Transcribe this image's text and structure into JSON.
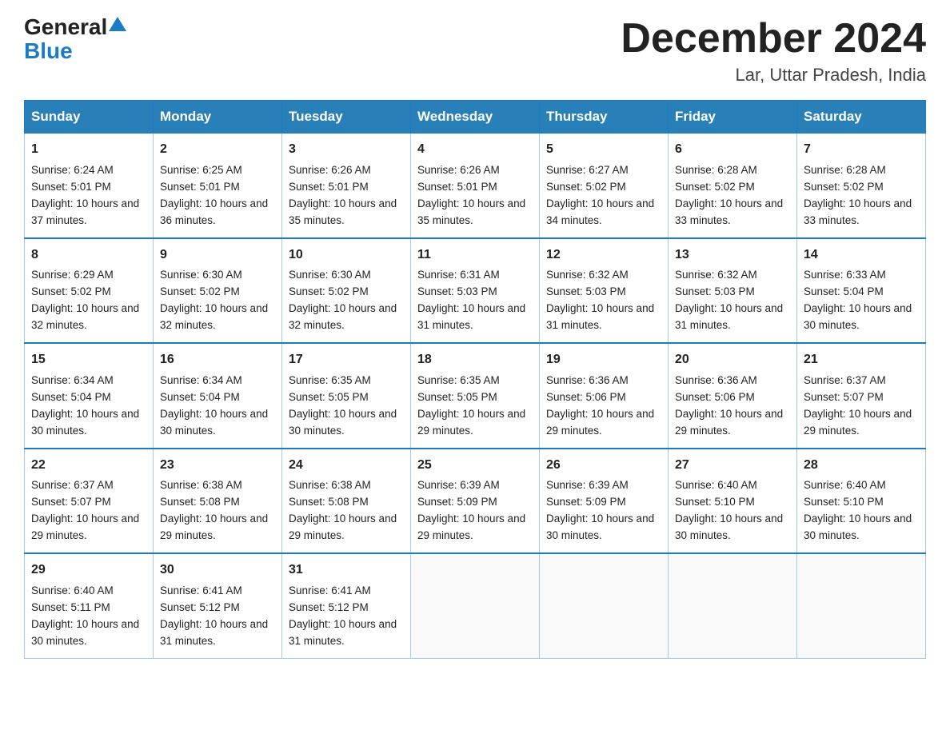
{
  "logo": {
    "general": "General",
    "blue": "Blue",
    "triangle": "▲"
  },
  "title": "December 2024",
  "location": "Lar, Uttar Pradesh, India",
  "days_of_week": [
    "Sunday",
    "Monday",
    "Tuesday",
    "Wednesday",
    "Thursday",
    "Friday",
    "Saturday"
  ],
  "weeks": [
    [
      {
        "day": "1",
        "sunrise": "6:24 AM",
        "sunset": "5:01 PM",
        "daylight": "10 hours and 37 minutes."
      },
      {
        "day": "2",
        "sunrise": "6:25 AM",
        "sunset": "5:01 PM",
        "daylight": "10 hours and 36 minutes."
      },
      {
        "day": "3",
        "sunrise": "6:26 AM",
        "sunset": "5:01 PM",
        "daylight": "10 hours and 35 minutes."
      },
      {
        "day": "4",
        "sunrise": "6:26 AM",
        "sunset": "5:01 PM",
        "daylight": "10 hours and 35 minutes."
      },
      {
        "day": "5",
        "sunrise": "6:27 AM",
        "sunset": "5:02 PM",
        "daylight": "10 hours and 34 minutes."
      },
      {
        "day": "6",
        "sunrise": "6:28 AM",
        "sunset": "5:02 PM",
        "daylight": "10 hours and 33 minutes."
      },
      {
        "day": "7",
        "sunrise": "6:28 AM",
        "sunset": "5:02 PM",
        "daylight": "10 hours and 33 minutes."
      }
    ],
    [
      {
        "day": "8",
        "sunrise": "6:29 AM",
        "sunset": "5:02 PM",
        "daylight": "10 hours and 32 minutes."
      },
      {
        "day": "9",
        "sunrise": "6:30 AM",
        "sunset": "5:02 PM",
        "daylight": "10 hours and 32 minutes."
      },
      {
        "day": "10",
        "sunrise": "6:30 AM",
        "sunset": "5:02 PM",
        "daylight": "10 hours and 32 minutes."
      },
      {
        "day": "11",
        "sunrise": "6:31 AM",
        "sunset": "5:03 PM",
        "daylight": "10 hours and 31 minutes."
      },
      {
        "day": "12",
        "sunrise": "6:32 AM",
        "sunset": "5:03 PM",
        "daylight": "10 hours and 31 minutes."
      },
      {
        "day": "13",
        "sunrise": "6:32 AM",
        "sunset": "5:03 PM",
        "daylight": "10 hours and 31 minutes."
      },
      {
        "day": "14",
        "sunrise": "6:33 AM",
        "sunset": "5:04 PM",
        "daylight": "10 hours and 30 minutes."
      }
    ],
    [
      {
        "day": "15",
        "sunrise": "6:34 AM",
        "sunset": "5:04 PM",
        "daylight": "10 hours and 30 minutes."
      },
      {
        "day": "16",
        "sunrise": "6:34 AM",
        "sunset": "5:04 PM",
        "daylight": "10 hours and 30 minutes."
      },
      {
        "day": "17",
        "sunrise": "6:35 AM",
        "sunset": "5:05 PM",
        "daylight": "10 hours and 30 minutes."
      },
      {
        "day": "18",
        "sunrise": "6:35 AM",
        "sunset": "5:05 PM",
        "daylight": "10 hours and 29 minutes."
      },
      {
        "day": "19",
        "sunrise": "6:36 AM",
        "sunset": "5:06 PM",
        "daylight": "10 hours and 29 minutes."
      },
      {
        "day": "20",
        "sunrise": "6:36 AM",
        "sunset": "5:06 PM",
        "daylight": "10 hours and 29 minutes."
      },
      {
        "day": "21",
        "sunrise": "6:37 AM",
        "sunset": "5:07 PM",
        "daylight": "10 hours and 29 minutes."
      }
    ],
    [
      {
        "day": "22",
        "sunrise": "6:37 AM",
        "sunset": "5:07 PM",
        "daylight": "10 hours and 29 minutes."
      },
      {
        "day": "23",
        "sunrise": "6:38 AM",
        "sunset": "5:08 PM",
        "daylight": "10 hours and 29 minutes."
      },
      {
        "day": "24",
        "sunrise": "6:38 AM",
        "sunset": "5:08 PM",
        "daylight": "10 hours and 29 minutes."
      },
      {
        "day": "25",
        "sunrise": "6:39 AM",
        "sunset": "5:09 PM",
        "daylight": "10 hours and 29 minutes."
      },
      {
        "day": "26",
        "sunrise": "6:39 AM",
        "sunset": "5:09 PM",
        "daylight": "10 hours and 30 minutes."
      },
      {
        "day": "27",
        "sunrise": "6:40 AM",
        "sunset": "5:10 PM",
        "daylight": "10 hours and 30 minutes."
      },
      {
        "day": "28",
        "sunrise": "6:40 AM",
        "sunset": "5:10 PM",
        "daylight": "10 hours and 30 minutes."
      }
    ],
    [
      {
        "day": "29",
        "sunrise": "6:40 AM",
        "sunset": "5:11 PM",
        "daylight": "10 hours and 30 minutes."
      },
      {
        "day": "30",
        "sunrise": "6:41 AM",
        "sunset": "5:12 PM",
        "daylight": "10 hours and 31 minutes."
      },
      {
        "day": "31",
        "sunrise": "6:41 AM",
        "sunset": "5:12 PM",
        "daylight": "10 hours and 31 minutes."
      },
      null,
      null,
      null,
      null
    ]
  ],
  "labels": {
    "sunrise": "Sunrise:",
    "sunset": "Sunset:",
    "daylight": "Daylight:"
  }
}
